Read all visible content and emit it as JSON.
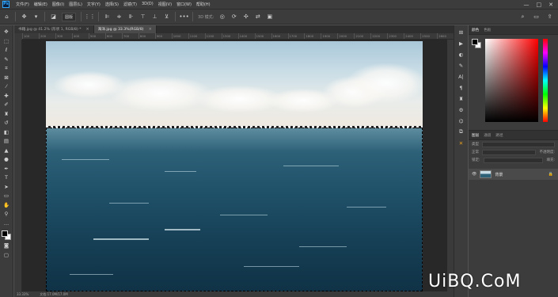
{
  "app": {
    "logo": "Ps",
    "menu": [
      "文件(F)",
      "编辑(E)",
      "图像(I)",
      "图层(L)",
      "文字(Y)",
      "选择(S)",
      "滤镜(T)",
      "3D(D)",
      "视图(V)",
      "窗口(W)",
      "帮助(H)"
    ],
    "window_controls": [
      "—",
      "□",
      "✕"
    ]
  },
  "options_bar": {
    "mode_select": "圆版",
    "mode_label": "3D 模式:"
  },
  "tabs": [
    {
      "label": "书籍.jpg @ 41.2% (形状 1, RGB/8) *",
      "active": false
    },
    {
      "label": "海洋.jpg @ 33.3%(RGB/8)",
      "active": true
    }
  ],
  "ruler_ticks": [
    "100",
    "200",
    "300",
    "400",
    "500",
    "600",
    "700",
    "800",
    "900",
    "1000",
    "1100",
    "1200",
    "1300",
    "1400",
    "1500",
    "1600",
    "1700",
    "1800",
    "1900",
    "2000",
    "2100",
    "2200",
    "2300",
    "2400",
    "2500",
    "2600"
  ],
  "status": {
    "zoom": "33.33%",
    "doc": "文档:17.0M/17.0M"
  },
  "panels": {
    "color_tabs": [
      "颜色",
      "色板"
    ],
    "layer_tabs": [
      "图层",
      "通道",
      "路径"
    ],
    "filter_label": "类型",
    "blend_mode": "正常",
    "opacity_label": "不透明度:",
    "lock_label": "锁定:",
    "fill_label": "填充:",
    "layer_name": "背景"
  },
  "watermark": "UiBQ.CoM"
}
